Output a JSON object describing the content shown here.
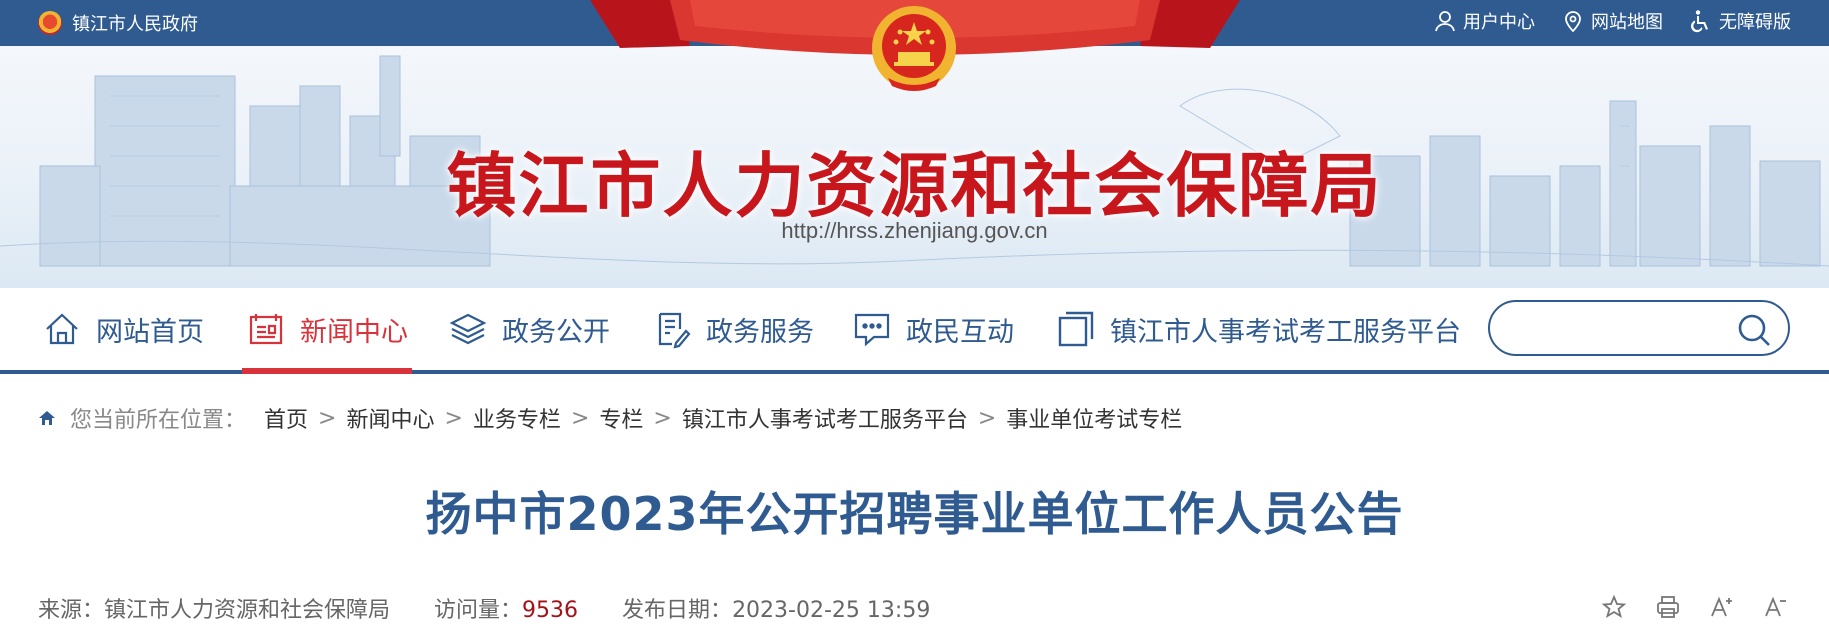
{
  "topbar": {
    "gov_name": "镇江市人民政府",
    "links": [
      {
        "label": "用户中心",
        "icon": "user-icon"
      },
      {
        "label": "网站地图",
        "icon": "map-pin-icon"
      },
      {
        "label": "无障碍版",
        "icon": "accessibility-icon"
      }
    ]
  },
  "banner": {
    "title": "镇江市人力资源和社会保障局",
    "url": "http://hrss.zhenjiang.gov.cn"
  },
  "nav": {
    "items": [
      {
        "label": "网站首页",
        "icon": "home-icon",
        "active": false
      },
      {
        "label": "新闻中心",
        "icon": "news-icon",
        "active": true
      },
      {
        "label": "政务公开",
        "icon": "layers-icon",
        "active": false
      },
      {
        "label": "政务服务",
        "icon": "document-edit-icon",
        "active": false
      },
      {
        "label": "政民互动",
        "icon": "chat-icon",
        "active": false
      },
      {
        "label": "镇江市人事考试考工服务平台",
        "icon": "window-icon",
        "active": false
      }
    ],
    "search_placeholder": ""
  },
  "breadcrumb": {
    "label": "您当前所在位置：",
    "items": [
      "首页",
      "新闻中心",
      "业务专栏",
      "专栏",
      "镇江市人事考试考工服务平台",
      "事业单位考试专栏"
    ],
    "separator": ">"
  },
  "article": {
    "title": "扬中市2023年公开招聘事业单位工作人员公告",
    "source_label": "来源：",
    "source": "镇江市人力资源和社会保障局",
    "views_label": "访问量：",
    "views": "9536",
    "date_label": "发布日期：",
    "date": "2023-02-25 13:59"
  },
  "tools": [
    "star-icon",
    "print-icon",
    "font-increase-icon",
    "font-decrease-icon"
  ],
  "colors": {
    "primary": "#2f5b91",
    "accent": "#d8333a",
    "title_red": "#c8161d",
    "count_red": "#a3121a"
  }
}
